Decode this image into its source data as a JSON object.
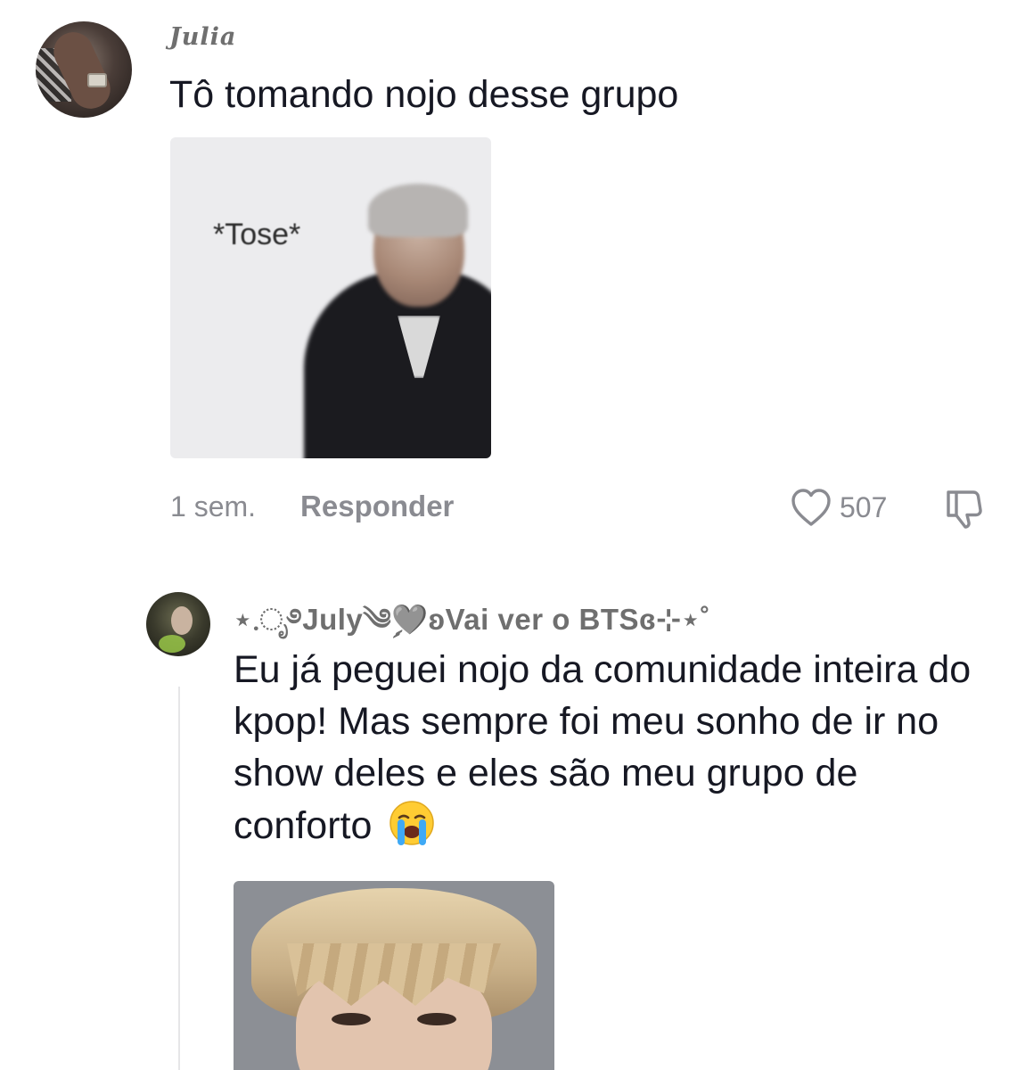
{
  "comment": {
    "username": "Julia",
    "text": "Tô tomando nojo desse grupo",
    "image_caption": "*Tose*",
    "time": "1 sem.",
    "reply_label": "Responder",
    "like_count": "507"
  },
  "reply": {
    "username_prefix": "⋆.ೃ࿔July༄ࣲ",
    "username_heart": "🩶",
    "username_suffix": "ʚVai ver o BTSɞ⊹⋆˚",
    "text": "Eu já peguei nojo da comunidade inteira do kpop! Mas sempre foi meu sonho de ir no show deles e eles são meu grupo de conforto",
    "emoji": "loudly-crying-face"
  },
  "colors": {
    "text_primary": "#161823",
    "text_secondary": "#8a8b91",
    "username": "#6f6f6f"
  }
}
